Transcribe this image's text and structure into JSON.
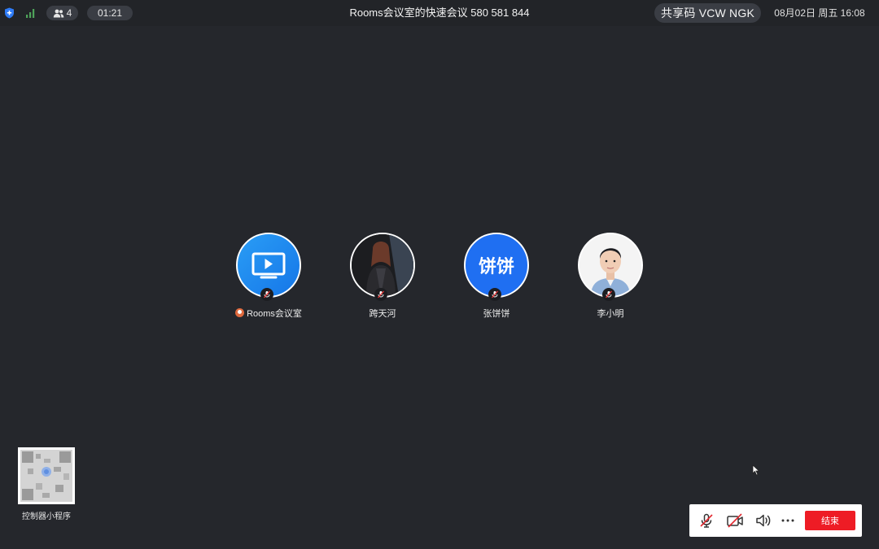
{
  "topbar": {
    "participant_count": "4",
    "elapsed_time": "01:21",
    "meeting_title": "Rooms会议室的快速会议 580 581 844",
    "share_code": "共享码 VCW NGK",
    "datetime": "08月02日  周五 16:08"
  },
  "participants": [
    {
      "name": "Rooms会议室",
      "avatar": "rooms-screen-icon",
      "host": true,
      "mic": "muted"
    },
    {
      "name": "跨天河",
      "avatar": "photo",
      "host": false,
      "mic": "muted"
    },
    {
      "name": "张饼饼",
      "avatar_text": "饼饼",
      "host": false,
      "mic": "muted"
    },
    {
      "name": "李小明",
      "avatar": "photo",
      "host": false,
      "mic": "muted"
    }
  ],
  "qr": {
    "label": "控制器小程序"
  },
  "controls": {
    "mic": "mic-muted-icon",
    "camera": "camera-off-icon",
    "speaker": "speaker-icon",
    "more": "more-icon",
    "end_label": "结束"
  },
  "colors": {
    "background": "#25272c",
    "accent_blue": "#1f6ff2",
    "end_red": "#ee1c25",
    "host_orange": "#e06a3e"
  }
}
